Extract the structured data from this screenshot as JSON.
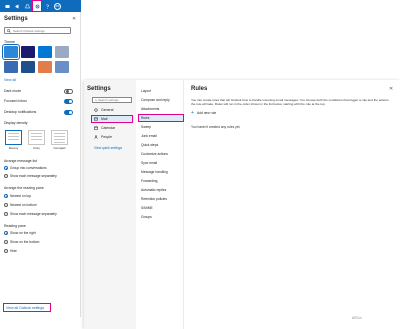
{
  "topbar": {
    "icons": [
      {
        "name": "teams-icon",
        "glyph": "▣"
      },
      {
        "name": "megaphone-icon",
        "glyph": "◀"
      },
      {
        "name": "bell-icon",
        "glyph": "◔"
      },
      {
        "name": "gear-icon",
        "glyph": "✲"
      },
      {
        "name": "help-icon",
        "glyph": "?"
      }
    ],
    "avatar_initials": "WK",
    "brand_color": "#0f6cbd",
    "highlight_color": "#e3008c"
  },
  "quick_settings": {
    "title": "Settings",
    "close_glyph": "✕",
    "search_placeholder": "Search Outlook settings",
    "theme_label": "Theme",
    "themes": [
      "#2b88d8",
      "#1a1a6e",
      "#0078d4",
      "#9aa9c4",
      "#3a6bb2",
      "#1f4e8c",
      "#e17d4a",
      "#6a8ec6"
    ],
    "view_all_themes": "View all",
    "dark_mode": {
      "label": "Dark mode",
      "on": false
    },
    "focused_inbox": {
      "label": "Focused Inbox",
      "on": true
    },
    "desktop_notifications": {
      "label": "Desktop notifications",
      "on": true
    },
    "display_density_label": "Display density",
    "densities": [
      "Roomy",
      "Cozy",
      "Compact"
    ],
    "arrange_label": "Arrange message list",
    "arrange_options": [
      "Group into conversations",
      "Show each message separately"
    ],
    "reading_label": "Arrange the reading pane",
    "reading_options": [
      "Newest on top",
      "Newest on bottom",
      "Show each message separately"
    ],
    "pane_label": "Reading pane",
    "pane_options": [
      "Show on the right",
      "Show on the bottom",
      "Hide"
    ],
    "view_all_settings": "View all Outlook settings"
  },
  "dialog": {
    "title": "Settings",
    "search_placeholder": "Search settings",
    "nav": [
      {
        "label": "General",
        "icon": "gear-icon"
      },
      {
        "label": "Mail",
        "icon": "mail-icon"
      },
      {
        "label": "Calendar",
        "icon": "calendar-icon"
      },
      {
        "label": "People",
        "icon": "people-icon"
      }
    ],
    "view_quick_settings": "View quick settings",
    "sub_nav": [
      "Layout",
      "Compose and reply",
      "Attachments",
      "Rules",
      "Sweep",
      "Junk email",
      "Quick steps",
      "Customize actions",
      "Sync email",
      "Message handling",
      "Forwarding",
      "Automatic replies",
      "Retention policies",
      "S/MIME",
      "Groups"
    ],
    "main": {
      "title": "Rules",
      "close_glyph": "✕",
      "description": "You can create rules that tell Outlook how to handle incoming email messages. You choose both the conditions that trigger a rule and the actions the rule will take. Rules will run in the order shown in the list below, starting with the rule at the top.",
      "add_rule": "Add new rule",
      "no_rules": "You haven't created any rules yet."
    }
  },
  "watermark": "ARCcr"
}
